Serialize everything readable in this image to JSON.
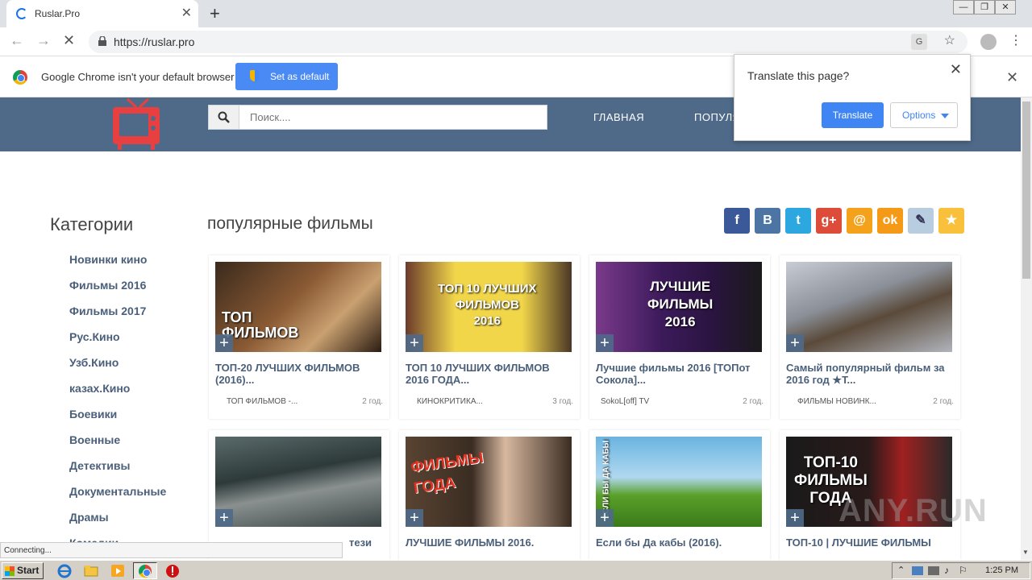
{
  "browser": {
    "tab_title": "Ruslar.Pro",
    "url": "https://ruslar.pro",
    "window_buttons": [
      "—",
      "❐",
      "✕"
    ]
  },
  "infobar": {
    "message": "Google Chrome isn't your default browser",
    "button_label": "Set as default"
  },
  "translate_bubble": {
    "title": "Translate this page?",
    "translate_label": "Translate",
    "options_label": "Options"
  },
  "header": {
    "search_placeholder": "Поиск....",
    "nav": [
      "ГЛАВНАЯ",
      "ПОПУЛЯ"
    ]
  },
  "sidebar": {
    "title": "Категории",
    "items": [
      "Новинки кино",
      "Фильмы 2016",
      "Фильмы 2017",
      "Рус.Кино",
      "Узб.Кино",
      "казах.Кино",
      "Боевики",
      "Военные",
      "Детективы",
      "Документальные",
      "Драмы",
      "Комедии"
    ]
  },
  "main": {
    "title": "популярные фильмы",
    "share_icons": [
      {
        "name": "facebook-icon",
        "glyph": "f",
        "color": "#3b5998"
      },
      {
        "name": "vk-icon",
        "glyph": "B",
        "color": "#4c75a3"
      },
      {
        "name": "twitter-icon",
        "glyph": "t",
        "color": "#2ca7e0"
      },
      {
        "name": "googleplus-icon",
        "glyph": "g+",
        "color": "#dd4b39"
      },
      {
        "name": "mailru-icon",
        "glyph": "@",
        "color": "#f4a21c"
      },
      {
        "name": "odnoklassniki-icon",
        "glyph": "ok",
        "color": "#f49a16"
      },
      {
        "name": "livejournal-icon",
        "glyph": "✎",
        "color": "#b8cde0"
      },
      {
        "name": "bookmark-star-icon",
        "glyph": "★",
        "color": "#f9c13b"
      }
    ],
    "cards": [
      {
        "title": "ТОП-20 ЛУЧШИХ ФИЛЬМОВ (2016)...",
        "channel": "ТОП ФИЛЬМОВ -...",
        "age": "2 год.",
        "thumb_text": "ТОП\nФИЛЬМОВ"
      },
      {
        "title": "ТОП 10 ЛУЧШИХ ФИЛЬМОВ 2016 ГОДА...",
        "channel": "КИНОКРИТИКА...",
        "age": "3 год.",
        "thumb_text": "ТОП 10 ЛУЧШИХ\nФИЛЬМОВ\n2016"
      },
      {
        "title": "Лучшие фильмы 2016 [ТОПот Сокола]...",
        "channel": "SokoL[off] TV",
        "age": "2 год.",
        "thumb_text": "ЛУЧШИЕ\nФИЛЬМЫ\n2016"
      },
      {
        "title": "Самый популярный фильм за 2016 год ★Т...",
        "channel": "ФИЛЬМЫ НОВИНК...",
        "age": "2 год.",
        "thumb_text": ""
      },
      {
        "title": "тези",
        "channel": "",
        "age": "",
        "thumb_text": ""
      },
      {
        "title": "ЛУЧШИЕ ФИЛЬМЫ 2016.",
        "channel": "",
        "age": "",
        "thumb_text": "ФИЛЬМЫ\nГОДА"
      },
      {
        "title": "Если бы Да кабы (2016).",
        "channel": "",
        "age": "",
        "thumb_text": "ЕСЛИ БЫ ДА КАБЫ"
      },
      {
        "title": "ТОП-10 | ЛУЧШИЕ ФИЛЬМЫ",
        "channel": "",
        "age": "",
        "thumb_text": "ТОП-10\nФИЛЬМЫ\nГОДА"
      }
    ]
  },
  "status": {
    "text": "Connecting..."
  },
  "watermark": "ANY.RUN",
  "taskbar": {
    "start_label": "Start",
    "clock": "1:25 PM"
  }
}
